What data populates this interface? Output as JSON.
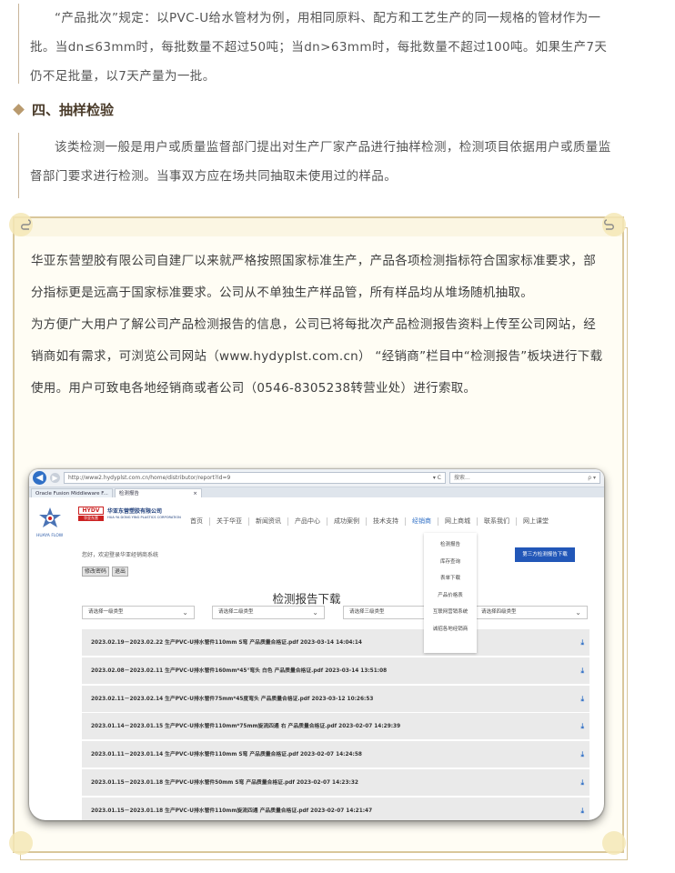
{
  "article": {
    "batch_paragraph": "“产品批次”规定：以PVC-U给水管材为例，用相同原料、配方和工艺生产的同一规格的管材作为一批。当dn≤63mm时，每批数量不超过50吨；当dn>63mm时，每批数量不超过100吨。如果生产7天仍不足批量，以7天产量为一批。",
    "section_heading": "四、抽样检验",
    "sampling_paragraph": "该类检测一般是用户或质量监督部门提出对生产厂家产品进行抽样检测，检测项目依据用户或质量监督部门要求进行检测。当事双方应在场共同抽取未使用过的样品。"
  },
  "note": {
    "paragraph1": "华亚东营塑胶有限公司自建厂以来就严格按照国家标准生产，产品各项检测指标符合国家标准要求，部分指标更是远高于国家标准要求。公司从不单独生产样品管，所有样品均从堆场随机抽取。",
    "paragraph2": "为方便广大用户了解公司产品检测报告的信息，公司已将每批次产品检测报告资料上传至公司网站，经销商如有需求，可浏览公司网站（www.hydyplst.com.cn） “经销商”栏目中“检测报告”板块进行下载使用。用户可致电各地经销商或者公司（0546-8305238转营业处）进行索取。"
  },
  "screenshot": {
    "browser": {
      "url": "http://www2.hydyplst.com.cn/home/distributor/report?id=9",
      "url_suffix": "▾ C",
      "search_placeholder": "搜索...",
      "search_icon": "ρ ▾",
      "tabs": [
        "Oracle Fusion Middleware F...",
        "检测报告"
      ],
      "tab_close": "×"
    },
    "site": {
      "logo_caption": "HUAYA FLOW",
      "brand_badge": "HYDV",
      "brand_badge_sub": "华亚东营",
      "company_cn": "华亚东营塑胶有限公司",
      "company_en": "HUA YA DONG YING PLASTICS CORPORATION",
      "nav": [
        "首页",
        "关于华亚",
        "新闻资讯",
        "产品中心",
        "成功案例",
        "技术支持",
        "经销商",
        "网上商城",
        "联系我们",
        "网上课堂"
      ],
      "active_nav": "经销商",
      "dropdown": [
        "检测报告",
        "库存查询",
        "表单下载",
        "产品价格表",
        "互联网营销系统",
        "诚招各地经销商"
      ],
      "welcome": "您好，欢迎登录华亚经销商系统",
      "buttons": [
        "修改密码",
        "退出"
      ],
      "third_party_button": "第三方检测报告下载",
      "page_heading": "检测报告下载",
      "selects": [
        "请选择一级类型",
        "请选择二级类型",
        "请选择三级类型",
        "请选择四级类型"
      ],
      "reports": [
        "2023.02.19－2023.02.22 生产PVC-U排水管件110mm S弯 产品质量合格证.pdf 2023-03-14 14:04:14",
        "2023.02.08－2023.02.11 生产PVC-U排水管件160mm*45°弯头 白色 产品质量合格证.pdf 2023-03-14 13:51:08",
        "2023.02.11－2023.02.14 生产PVC-U排水管件75mm*45度弯头 产品质量合格证.pdf 2023-03-12 10:26:53",
        "2023.01.14－2023.01.15 生产PVC-U排水管件110mm*75mm旋流四通 右 产品质量合格证.pdf 2023-02-07 14:29:39",
        "2023.01.11－2023.01.14 生产PVC-U排水管件110mm S弯 产品质量合格证.pdf 2023-02-07 14:24:58",
        "2023.01.15－2023.01.18 生产PVC-U排水管件50mm S弯 产品质量合格证.pdf 2023-02-07 14:23:32",
        "2023.01.15－2023.01.18 生产PVC-U排水管件110mm旋流四通 产品质量合格证.pdf 2023-02-07 14:21:47"
      ],
      "download_icon": "download-icon"
    }
  },
  "colors": {
    "frame_border": "#d9c79b",
    "accent_blue": "#2f6fc6",
    "section_diamond": "#b99a6e"
  }
}
